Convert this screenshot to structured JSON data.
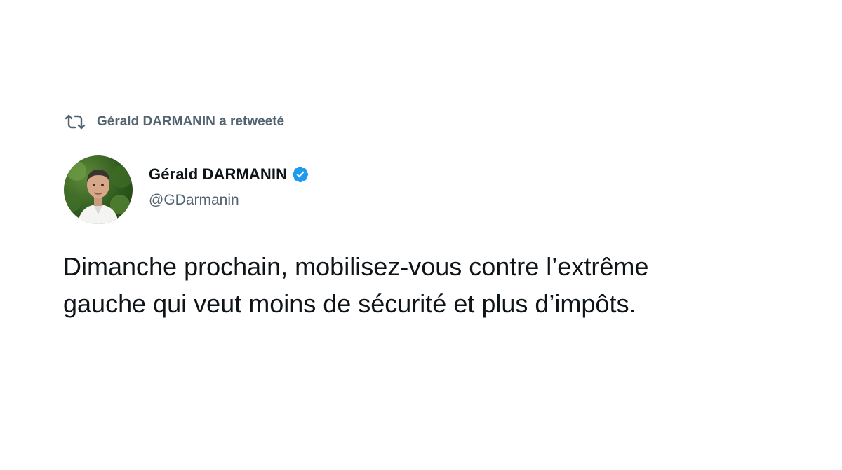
{
  "retweet": {
    "icon": "retweet-icon",
    "label": "Gérald DARMANIN a retweeté"
  },
  "author": {
    "avatar": "avatar",
    "name": "Gérald DARMANIN",
    "verified_icon": "verified-badge-icon",
    "handle": "@GDarmanin"
  },
  "tweet": {
    "lines": [
      "Dimanche prochain, mobilisez-vous contre l’extrême",
      "gauche qui veut moins de sécurité et plus d’impôts."
    ]
  },
  "colors": {
    "text_primary": "#0f1419",
    "text_secondary": "#536471",
    "verified_blue": "#1d9bf0"
  }
}
